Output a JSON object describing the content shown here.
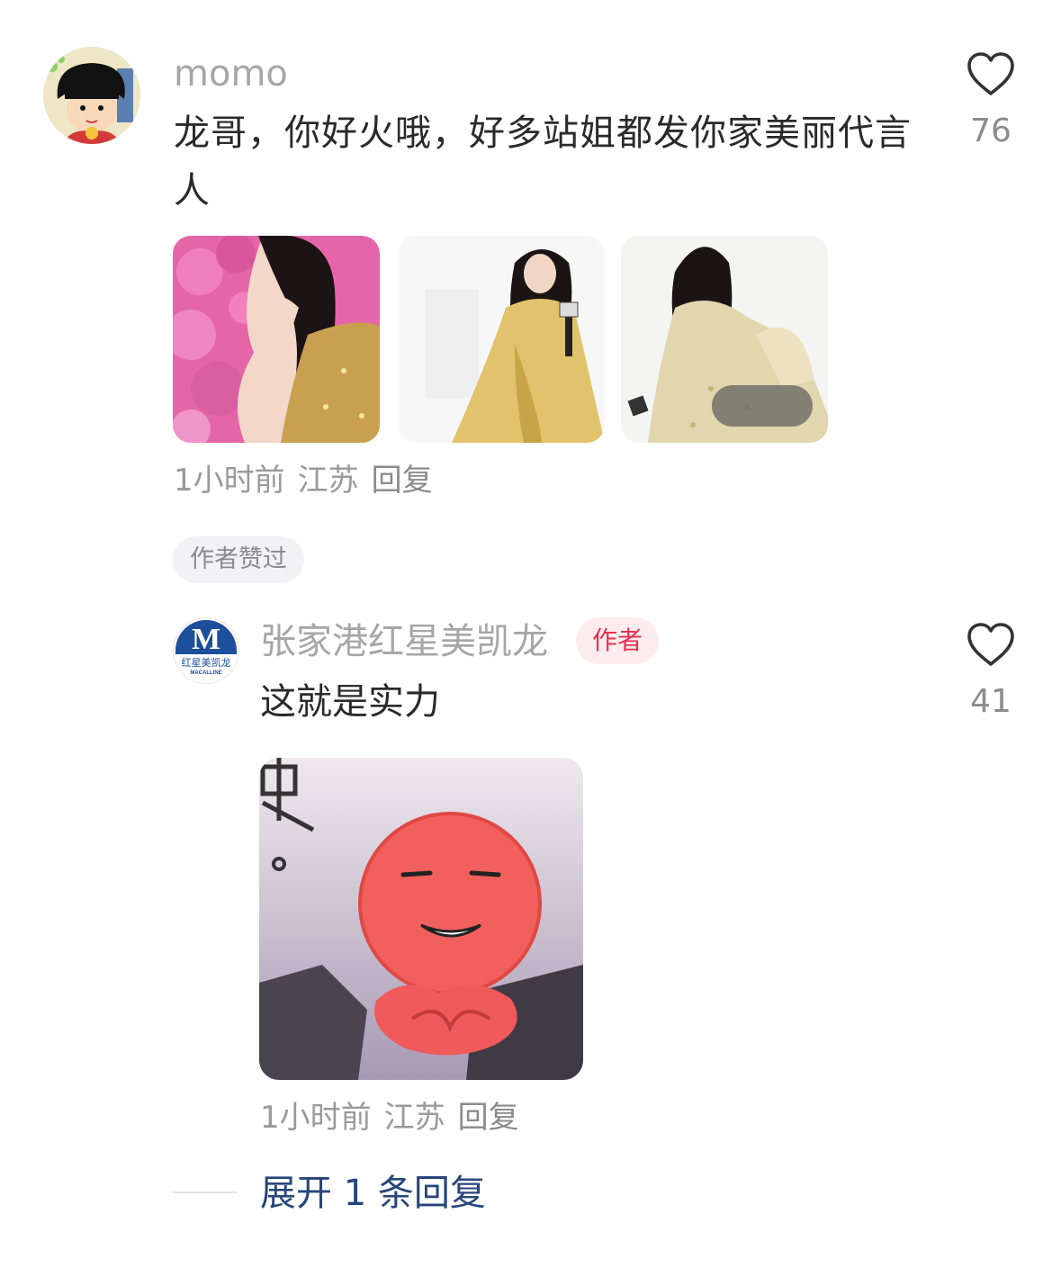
{
  "comment": {
    "avatar_icon": "cartoon-girl-avatar",
    "username": "momo",
    "text": "龙哥，你好火哦，好多站姐都发你家美丽代言人",
    "like_count": "76",
    "images": [
      {
        "name": "photo-pink-flowers-gold-dress"
      },
      {
        "name": "photo-gold-gown-microphone"
      },
      {
        "name": "photo-gold-gown-side"
      }
    ],
    "meta": {
      "time": "1小时前",
      "location": "江苏",
      "reply_label": "回复"
    },
    "author_liked_label": "作者赞过"
  },
  "reply": {
    "avatar_icon": "macalline-logo-avatar",
    "avatar_letter": "M",
    "avatar_caption": "红星美凯龙",
    "avatar_caption_en": "MACALLINE",
    "username": "张家港红星美凯龙",
    "author_tag": "作者",
    "text": "这就是实力",
    "like_count": "41",
    "sticker_name": "red-face-meme-sticker",
    "meta": {
      "time": "1小时前",
      "location": "江苏",
      "reply_label": "回复"
    }
  },
  "expand_replies_label": "展开 1 条回复",
  "colors": {
    "username": "#a6a6a6",
    "author_tag_text": "#e8324f",
    "author_tag_bg": "#fdecef",
    "expand_link": "#26467a",
    "brand_blue": "#1d4f9c"
  }
}
